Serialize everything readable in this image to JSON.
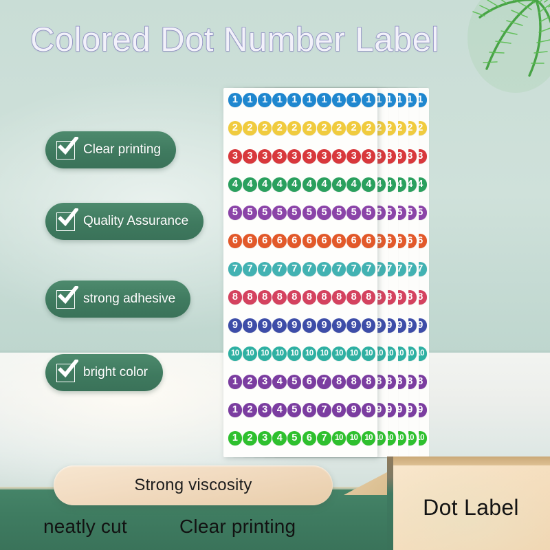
{
  "page": {
    "title": "Colored Dot Number Label",
    "background_upper": "#cfe1da",
    "background_lower": "#f0f3f0",
    "table_green": "#3f7c61"
  },
  "features": [
    {
      "label": "Clear printing",
      "icon": "checkbox-checked-icon"
    },
    {
      "label": "Quality Assurance",
      "icon": "checkbox-checked-icon"
    },
    {
      "label": "strong adhesive",
      "icon": "checkbox-checked-icon"
    },
    {
      "label": "bright color",
      "icon": "checkbox-checked-icon"
    }
  ],
  "sticker_sheet": {
    "columns": 10,
    "rows": 13,
    "uniform_rows": [
      {
        "number": "1",
        "color": "#1f87cf"
      },
      {
        "number": "2",
        "color": "#f0cb3e"
      },
      {
        "number": "3",
        "color": "#d8383c"
      },
      {
        "number": "4",
        "color": "#2aa05e"
      },
      {
        "number": "5",
        "color": "#8b44a8"
      },
      {
        "number": "6",
        "color": "#e2592a"
      },
      {
        "number": "7",
        "color": "#42b2b2"
      },
      {
        "number": "8",
        "color": "#d4425f"
      },
      {
        "number": "9",
        "color": "#3d4da8"
      },
      {
        "number": "10",
        "color": "#2eb0a2"
      }
    ],
    "sequence_rows": [
      {
        "color": "#7b3da0",
        "numbers": [
          "1",
          "2",
          "3",
          "4",
          "5",
          "6",
          "7",
          "8"
        ]
      },
      {
        "color": "#7b3da0",
        "numbers": [
          "1",
          "2",
          "3",
          "4",
          "5",
          "6",
          "7",
          "9"
        ]
      },
      {
        "color": "#2ec02e",
        "numbers": [
          "1",
          "2",
          "3",
          "4",
          "5",
          "6",
          "7",
          "10",
          "10"
        ]
      }
    ],
    "stack_count": 5
  },
  "bottom": {
    "viscosity_label": "Strong viscosity",
    "words": [
      "neatly cut",
      "Clear printing"
    ],
    "panel_label": "Dot Label"
  },
  "decor": {
    "palm_icon": "palm-leaf-icon"
  }
}
